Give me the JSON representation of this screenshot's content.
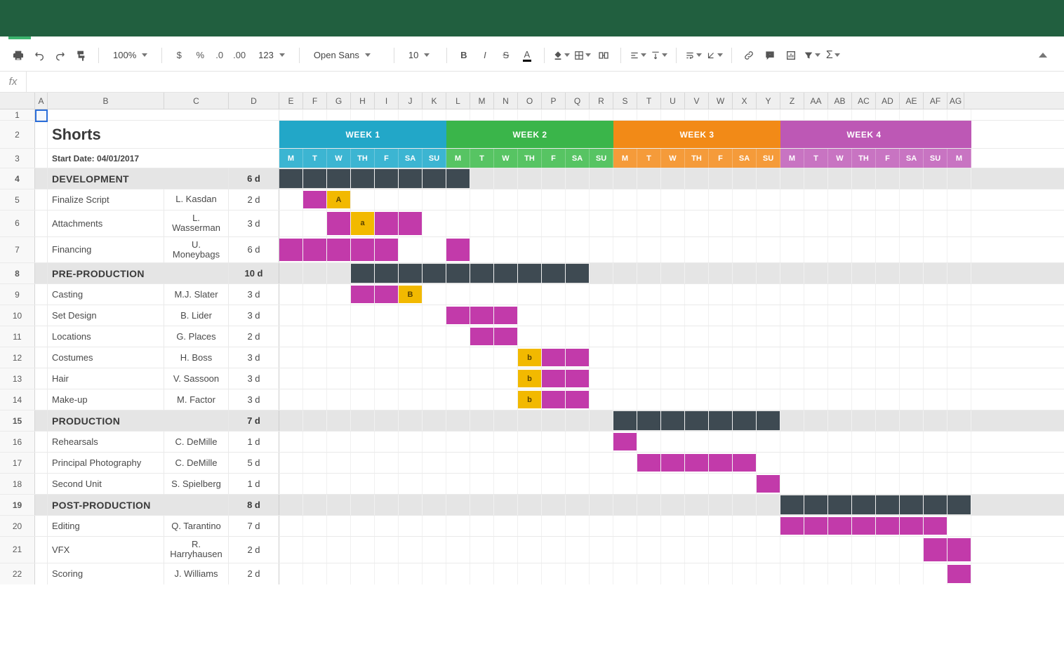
{
  "toolbar": {
    "zoom": "100%",
    "font": "Open Sans",
    "font_size": "10",
    "fmt_currency": "$",
    "fmt_percent": "%",
    "fmt_dec_dec": ".0",
    "fmt_inc_dec": ".00",
    "fmt_more": "123"
  },
  "columns": [
    "A",
    "B",
    "C",
    "D",
    "E",
    "F",
    "G",
    "H",
    "I",
    "J",
    "K",
    "L",
    "M",
    "N",
    "O",
    "P",
    "Q",
    "R",
    "S",
    "T",
    "U",
    "V",
    "W",
    "X",
    "Y",
    "Z",
    "AA",
    "AB",
    "AC",
    "AD",
    "AE",
    "AF",
    "AG"
  ],
  "title": "Shorts",
  "start_date_label": "Start Date: 04/01/2017",
  "weeks": [
    {
      "label": "WEEK 1",
      "color": "#22a7c8",
      "day_color": "#3cb5d2"
    },
    {
      "label": "WEEK 2",
      "color": "#3ab54a",
      "day_color": "#57c463"
    },
    {
      "label": "WEEK 3",
      "color": "#f28a17",
      "day_color": "#f59b3a"
    },
    {
      "label": "WEEK 4",
      "color": "#bd58b5",
      "day_color": "#c874c2"
    }
  ],
  "days": [
    "M",
    "T",
    "W",
    "TH",
    "F",
    "SA",
    "SU"
  ],
  "last_day_label": "M",
  "rows": [
    {
      "n": 1,
      "type": "first"
    },
    {
      "n": 2,
      "type": "weekhdr"
    },
    {
      "n": 3,
      "type": "dayhdr"
    },
    {
      "n": 4,
      "type": "section",
      "name": "DEVELOPMENT",
      "dur": "6 d",
      "span": [
        0,
        7
      ]
    },
    {
      "n": 5,
      "type": "task",
      "name": "Finalize Script",
      "owner": "L. Kasdan",
      "dur": "2 d",
      "cells": [
        {
          "i": 1,
          "c": "task"
        },
        {
          "i": 2,
          "c": "mile",
          "t": "A"
        }
      ]
    },
    {
      "n": 6,
      "type": "task",
      "name": "Attachments",
      "owner": "L. Wasserman",
      "dur": "3 d",
      "cells": [
        {
          "i": 2,
          "c": "task"
        },
        {
          "i": 3,
          "c": "mile",
          "t": "a"
        },
        {
          "i": 4,
          "c": "task"
        },
        {
          "i": 5,
          "c": "task"
        }
      ]
    },
    {
      "n": 7,
      "type": "task",
      "name": "Financing",
      "owner": "U. Moneybags",
      "dur": "6 d",
      "cells": [
        {
          "i": 0,
          "c": "task"
        },
        {
          "i": 1,
          "c": "task"
        },
        {
          "i": 2,
          "c": "task"
        },
        {
          "i": 3,
          "c": "task"
        },
        {
          "i": 4,
          "c": "task"
        },
        {
          "i": 7,
          "c": "task"
        }
      ]
    },
    {
      "n": 8,
      "type": "section",
      "name": "PRE-PRODUCTION",
      "dur": "10 d",
      "span": [
        3,
        12
      ]
    },
    {
      "n": 9,
      "type": "task",
      "name": "Casting",
      "owner": "M.J. Slater",
      "dur": "3 d",
      "cells": [
        {
          "i": 3,
          "c": "task"
        },
        {
          "i": 4,
          "c": "task"
        },
        {
          "i": 5,
          "c": "mile",
          "t": "B"
        }
      ]
    },
    {
      "n": 10,
      "type": "task",
      "name": "Set Design",
      "owner": "B. Lider",
      "dur": "3 d",
      "cells": [
        {
          "i": 7,
          "c": "task"
        },
        {
          "i": 8,
          "c": "task"
        },
        {
          "i": 9,
          "c": "task"
        }
      ]
    },
    {
      "n": 11,
      "type": "task",
      "name": "Locations",
      "owner": "G. Places",
      "dur": "2 d",
      "cells": [
        {
          "i": 8,
          "c": "task"
        },
        {
          "i": 9,
          "c": "task"
        }
      ]
    },
    {
      "n": 12,
      "type": "task",
      "name": "Costumes",
      "owner": "H. Boss",
      "dur": "3 d",
      "cells": [
        {
          "i": 10,
          "c": "mile",
          "t": "b"
        },
        {
          "i": 11,
          "c": "task"
        },
        {
          "i": 12,
          "c": "task"
        }
      ]
    },
    {
      "n": 13,
      "type": "task",
      "name": "Hair",
      "owner": "V. Sassoon",
      "dur": "3 d",
      "cells": [
        {
          "i": 10,
          "c": "mile",
          "t": "b"
        },
        {
          "i": 11,
          "c": "task"
        },
        {
          "i": 12,
          "c": "task"
        }
      ]
    },
    {
      "n": 14,
      "type": "task",
      "name": "Make-up",
      "owner": "M. Factor",
      "dur": "3 d",
      "cells": [
        {
          "i": 10,
          "c": "mile",
          "t": "b"
        },
        {
          "i": 11,
          "c": "task"
        },
        {
          "i": 12,
          "c": "task"
        }
      ]
    },
    {
      "n": 15,
      "type": "section",
      "name": "PRODUCTION",
      "dur": "7 d",
      "span": [
        14,
        20
      ]
    },
    {
      "n": 16,
      "type": "task",
      "name": "Rehearsals",
      "owner": "C. DeMille",
      "dur": "1 d",
      "cells": [
        {
          "i": 14,
          "c": "task"
        }
      ]
    },
    {
      "n": 17,
      "type": "task",
      "name": "Principal Photography",
      "owner": "C. DeMille",
      "dur": "5 d",
      "cells": [
        {
          "i": 15,
          "c": "task"
        },
        {
          "i": 16,
          "c": "task"
        },
        {
          "i": 17,
          "c": "task"
        },
        {
          "i": 18,
          "c": "task"
        },
        {
          "i": 19,
          "c": "task"
        }
      ]
    },
    {
      "n": 18,
      "type": "task",
      "name": "Second Unit",
      "owner": "S. Spielberg",
      "dur": "1 d",
      "cells": [
        {
          "i": 20,
          "c": "task"
        }
      ]
    },
    {
      "n": 19,
      "type": "section",
      "name": "POST-PRODUCTION",
      "dur": "8 d",
      "span": [
        21,
        28
      ]
    },
    {
      "n": 20,
      "type": "task",
      "name": "Editing",
      "owner": "Q. Tarantino",
      "dur": "7 d",
      "cells": [
        {
          "i": 21,
          "c": "task"
        },
        {
          "i": 22,
          "c": "task"
        },
        {
          "i": 23,
          "c": "task"
        },
        {
          "i": 24,
          "c": "task"
        },
        {
          "i": 25,
          "c": "task"
        },
        {
          "i": 26,
          "c": "task"
        },
        {
          "i": 27,
          "c": "task"
        }
      ]
    },
    {
      "n": 21,
      "type": "task",
      "name": "VFX",
      "owner": "R. Harryhausen",
      "dur": "2 d",
      "cells": [
        {
          "i": 27,
          "c": "task"
        },
        {
          "i": 28,
          "c": "task"
        }
      ]
    },
    {
      "n": 22,
      "type": "task",
      "name": "Scoring",
      "owner": "J. Williams",
      "dur": "2 d",
      "cells": [
        {
          "i": 28,
          "c": "task"
        }
      ]
    }
  ],
  "day_count": 29
}
